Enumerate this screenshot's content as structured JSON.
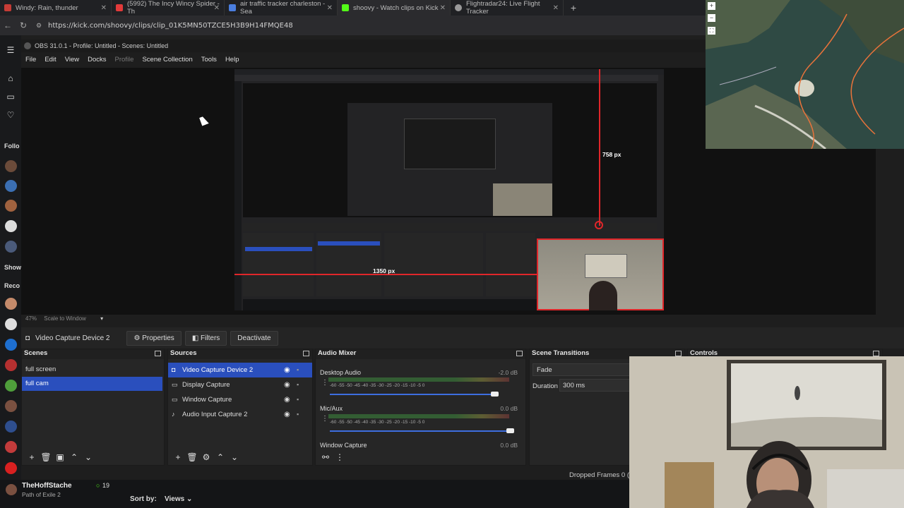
{
  "browser": {
    "tabs": [
      {
        "title": "Windy: Rain, thunder",
        "color": "#c63c36"
      },
      {
        "title": "(5992) The Incy Wincy Spider - Th",
        "color": "#e23a3a"
      },
      {
        "title": "air traffic tracker charleston - Sea",
        "color": "#4a7ee0"
      },
      {
        "title": "shoovy - Watch clips on Kick",
        "color": "#53fc18"
      },
      {
        "title": "Flightradar24: Live Flight Tracker",
        "color": "#999999"
      }
    ],
    "new_tab": "+",
    "url": "https://kick.com/shoovy/clips/clip_01K5MN50TZCE5H3B9H14FMQE48"
  },
  "kick_sidebar": {
    "following_label": "Follo",
    "show_label": "Show",
    "recommended_label": "Reco"
  },
  "obs": {
    "title": "OBS 31.0.1 - Profile: Untitled - Scenes: Untitled",
    "menu": [
      "File",
      "Edit",
      "View",
      "Docks",
      "Profile",
      "Scene Collection",
      "Tools",
      "Help"
    ],
    "canvas_zoom": "47%",
    "scale_mode": "Scale to Window",
    "selected_source": "Video Capture Device 2",
    "buttons": {
      "properties": "Properties",
      "filters": "Filters",
      "deactivate": "Deactivate"
    },
    "overlay_labels": {
      "height": "758 px",
      "width": "1350 px"
    },
    "scenes": {
      "title": "Scenes",
      "items": [
        {
          "name": "full screen",
          "selected": false
        },
        {
          "name": "full cam",
          "selected": true
        }
      ]
    },
    "sources": {
      "title": "Sources",
      "items": [
        {
          "name": "Video Capture Device 2",
          "icon": "camera-icon",
          "selected": true
        },
        {
          "name": "Display Capture",
          "icon": "monitor-icon",
          "selected": false
        },
        {
          "name": "Window Capture",
          "icon": "window-icon",
          "selected": false
        },
        {
          "name": "Audio Input Capture 2",
          "icon": "microphone-icon",
          "selected": false
        }
      ]
    },
    "audio_mixer": {
      "title": "Audio Mixer",
      "ticks": "-60  -55  -50  -45  -40  -35  -30  -25  -20  -15  -10  -5  0",
      "channels": [
        {
          "name": "Desktop Audio",
          "db": "-2.0 dB"
        },
        {
          "name": "Mic/Aux",
          "db": "0.0 dB"
        },
        {
          "name": "Window Capture",
          "db": "0.0 dB"
        }
      ]
    },
    "transitions": {
      "title": "Scene Transitions",
      "type": "Fade",
      "duration_label": "Duration",
      "duration_value": "300 ms"
    },
    "controls": {
      "title": "Controls"
    },
    "status": {
      "dropped_frames": "Dropped Frames 0 (0."
    }
  },
  "kick_bottom": {
    "streamer": "TheHoffStache",
    "category": "Path of Exile 2",
    "viewers": "19",
    "sort_label": "Sort by:",
    "sort_value": "Views"
  },
  "colors": {
    "accent": "#2a4fbd",
    "kick_green": "#53fc18",
    "red_guide": "#e0262a"
  }
}
